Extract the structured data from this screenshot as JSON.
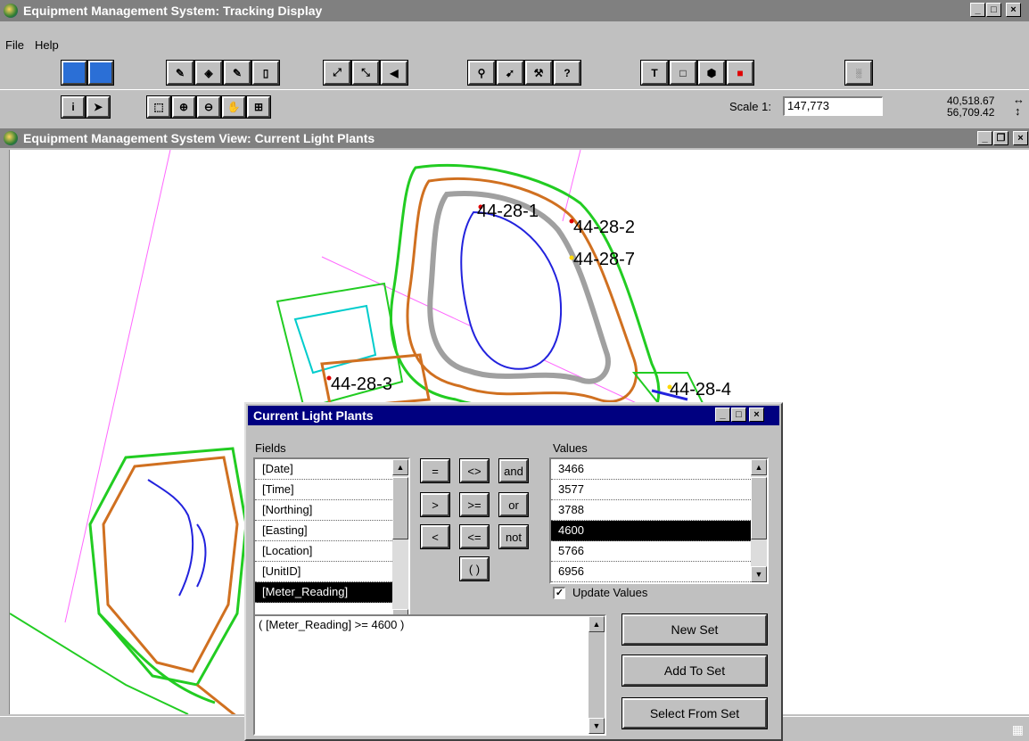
{
  "app": {
    "title": "Equipment Management System: Tracking Display",
    "min": "_",
    "max": "□",
    "close": "×"
  },
  "menu": {
    "file": "File",
    "help": "Help"
  },
  "toolbar": {
    "scale_label": "Scale 1:",
    "scale_value": "147,773",
    "coord_x": "40,518.67",
    "coord_y": "56,709.42"
  },
  "view": {
    "title": "Equipment Management System View: Current Light Plants",
    "min": "_",
    "restore": "❐",
    "close": "×"
  },
  "map": {
    "labels": [
      {
        "text": "44-28-1"
      },
      {
        "text": "44-28-2"
      },
      {
        "text": "44-28-7"
      },
      {
        "text": "44-28-3"
      },
      {
        "text": "44-28-4"
      }
    ]
  },
  "dialog": {
    "title": "Current Light Plants",
    "min": "_",
    "max": "□",
    "close": "×",
    "fields_label": "Fields",
    "fields": [
      "[Date]",
      "[Time]",
      "[Northing]",
      "[Easting]",
      "[Location]",
      "[UnitID]",
      "[Meter_Reading]"
    ],
    "values_label": "Values",
    "values": [
      "3466",
      "3577",
      "3788",
      "4600",
      "5766",
      "6956"
    ],
    "operators": [
      "=",
      "<>",
      "and",
      ">",
      ">=",
      "or",
      "<",
      "<=",
      "not",
      "( )"
    ],
    "update_values_label": "Update Values",
    "update_values_checked": true,
    "expression": "( [Meter_Reading] >= 4600 )",
    "new_set": "New Set",
    "add_to_set": "Add To Set",
    "select_from_set": "Select From Set"
  }
}
